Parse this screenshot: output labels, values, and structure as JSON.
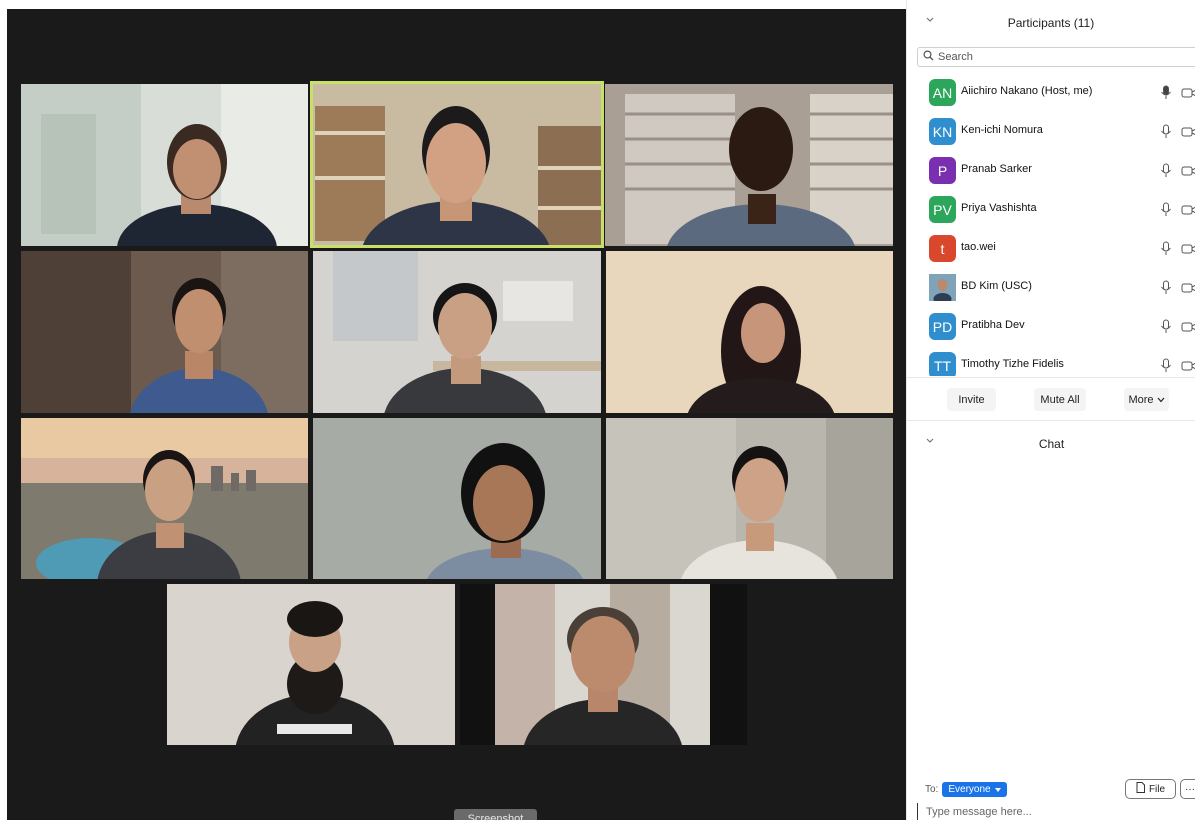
{
  "participants_panel": {
    "title": "Participants (11)",
    "search_placeholder": "Search",
    "participants": [
      {
        "initials": "AN",
        "name": "Aiichiro Nakano (Host, me)",
        "color": "#2ba65a",
        "mic": "active"
      },
      {
        "initials": "KN",
        "name": "Ken-ichi Nomura",
        "color": "#2f8fce",
        "mic": "muted"
      },
      {
        "initials": "P",
        "name": "Pranab Sarker",
        "color": "#7a2fb0",
        "mic": "muted"
      },
      {
        "initials": "PV",
        "name": "Priya Vashishta",
        "color": "#2ba65a",
        "mic": "muted"
      },
      {
        "initials": "t",
        "name": "tao.wei",
        "color": "#d9472c",
        "mic": "muted"
      },
      {
        "initials": "",
        "name": "BD Kim (USC)",
        "color": "#6b8fa8",
        "mic": "muted",
        "photo": true
      },
      {
        "initials": "PD",
        "name": "Pratibha Dev",
        "color": "#2f8fce",
        "mic": "muted"
      },
      {
        "initials": "TT",
        "name": "Timothy Tizhe Fidelis",
        "color": "#2f8fce",
        "mic": "muted"
      }
    ],
    "actions": {
      "invite": "Invite",
      "mute_all": "Mute All",
      "more": "More"
    }
  },
  "chat_panel": {
    "title": "Chat",
    "to_label": "To:",
    "to_value": "Everyone",
    "file_label": "File",
    "more_label": "···",
    "input_placeholder": "Type message here..."
  },
  "gallery": {
    "overlay_label": "Screenshot",
    "active_speaker_color": "#c8e06a"
  }
}
